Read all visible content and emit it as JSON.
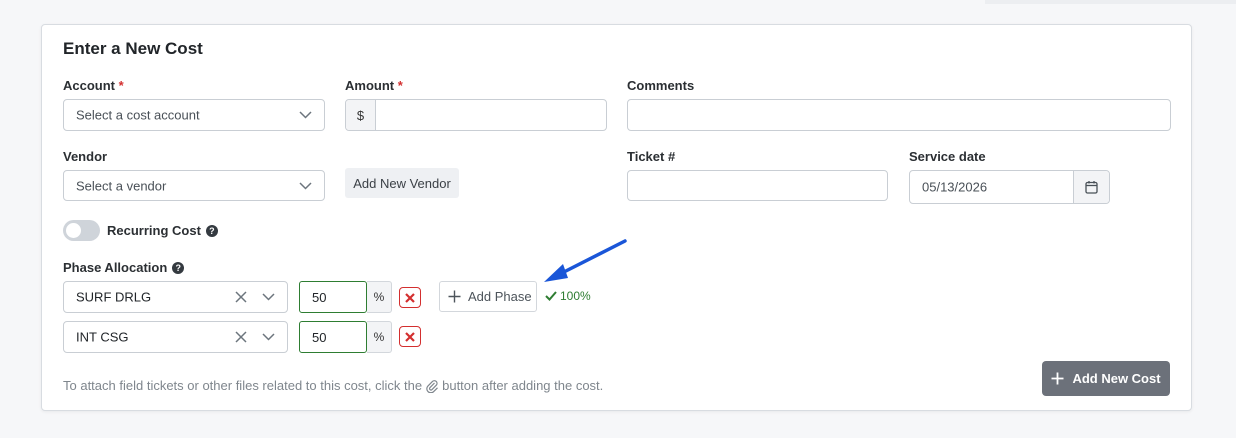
{
  "form": {
    "title": "Enter a New Cost",
    "account": {
      "label": "Account",
      "required_mark": "*",
      "placeholder": "Select a cost account"
    },
    "amount": {
      "label": "Amount",
      "required_mark": "*",
      "prefix": "$",
      "value": ""
    },
    "comments": {
      "label": "Comments",
      "value": ""
    },
    "vendor": {
      "label": "Vendor",
      "placeholder": "Select a vendor",
      "add_button": "Add New Vendor"
    },
    "ticket": {
      "label": "Ticket #",
      "value": ""
    },
    "service_date": {
      "label": "Service date",
      "value": "05/13/2026"
    },
    "recurring": {
      "label": "Recurring Cost",
      "enabled": false
    },
    "phase_allocation": {
      "label": "Phase Allocation",
      "rows": [
        {
          "phase": "SURF DRLG",
          "percent": "50",
          "unit": "%"
        },
        {
          "phase": "INT CSG",
          "percent": "50",
          "unit": "%"
        }
      ],
      "add_button": "Add Phase",
      "total_status": "100%"
    },
    "footer": {
      "note_before": "To attach field tickets or other files related to this cost, click the",
      "note_after": "button after adding the cost."
    },
    "submit_label": "Add New Cost"
  },
  "colors": {
    "required": "#d32f2f",
    "valid_green": "#2e7d32",
    "delete_red": "#d32f2f",
    "submit_bg": "#6c717a",
    "annotation_arrow": "#1a56d8"
  }
}
